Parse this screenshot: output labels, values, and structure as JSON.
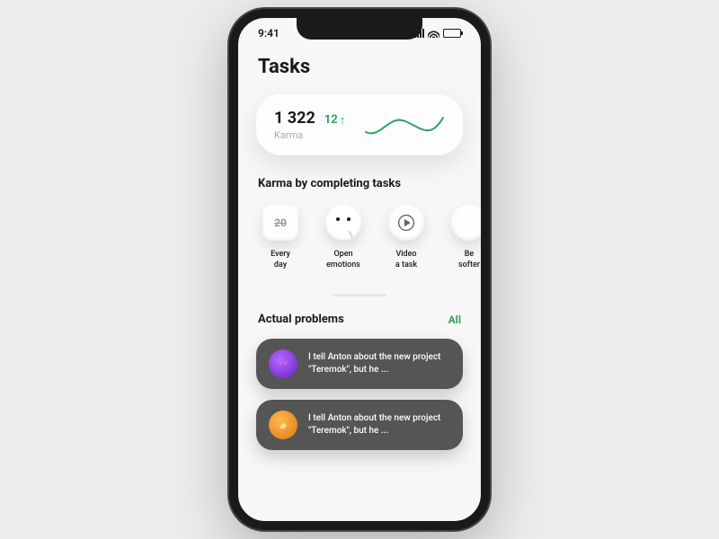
{
  "status": {
    "time": "9:41"
  },
  "page": {
    "title": "Tasks"
  },
  "karma": {
    "value": "1 322",
    "delta": "12",
    "arrow": "↑",
    "label": "Karma"
  },
  "tasks": {
    "heading": "Karma by completing tasks",
    "items": [
      {
        "icon": "calendar-20",
        "label_line1": "Every",
        "label_line2": "day"
      },
      {
        "icon": "emoji",
        "label_line1": "Open",
        "label_line2": "emotions"
      },
      {
        "icon": "play",
        "label_line1": "Video",
        "label_line2": "a task"
      },
      {
        "icon": "circle",
        "label_line1": "Be",
        "label_line2": "softer"
      }
    ]
  },
  "problems": {
    "heading": "Actual problems",
    "all_label": "All",
    "items": [
      {
        "avatar": "purple",
        "text_line1": "I tell Anton about the new project",
        "text_line2": "\"Teremok\", but he ..."
      },
      {
        "avatar": "orange",
        "text_line1": "I tell Anton about the new project",
        "text_line2": "\"Teremok\", but he ..."
      }
    ]
  },
  "colors": {
    "accent": "#2fa360"
  }
}
